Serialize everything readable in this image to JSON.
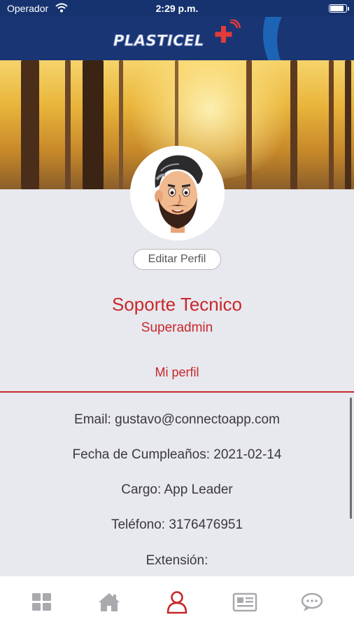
{
  "status_bar": {
    "carrier": "Operador",
    "time": "2:29 p.m.",
    "battery_level": 0.9
  },
  "header": {
    "logo_text": "PLASTICEL"
  },
  "profile": {
    "edit_button_label": "Editar Perfil",
    "name": "Soporte Tecnico",
    "role": "Superadmin",
    "section_title": "Mi perfil",
    "details": [
      {
        "label": "Email:",
        "value": "gustavo@connectoapp.com"
      },
      {
        "label": "Fecha de Cumpleaños:",
        "value": "2021-02-14"
      },
      {
        "label": "Cargo:",
        "value": "App Leader"
      },
      {
        "label": "Teléfono:",
        "value": "3176476951"
      },
      {
        "label": "Extensión:",
        "value": ""
      }
    ]
  },
  "colors": {
    "accent": "#c72828",
    "header_blue": "#1a3574",
    "tab_inactive": "#a9a9ae"
  },
  "tab_bar": {
    "items": [
      {
        "icon": "grid-icon",
        "active": false
      },
      {
        "icon": "home-icon",
        "active": false
      },
      {
        "icon": "profile-icon",
        "active": true
      },
      {
        "icon": "news-icon",
        "active": false
      },
      {
        "icon": "chat-icon",
        "active": false
      }
    ]
  }
}
